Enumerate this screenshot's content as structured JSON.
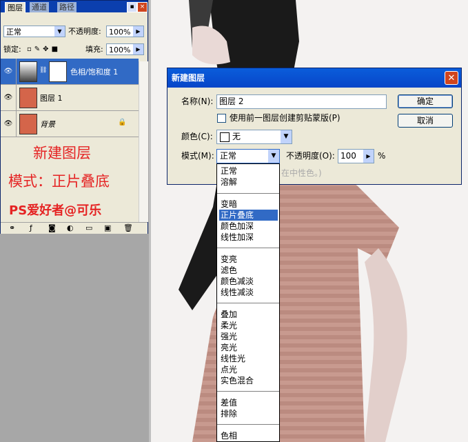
{
  "layers_panel": {
    "tabs": [
      "图层",
      "通道",
      "路径"
    ],
    "blend_mode": "正常",
    "opacity_label": "不透明度:",
    "opacity_value": "100%",
    "lock_label": "锁定:",
    "fill_label": "填充:",
    "fill_value": "100%",
    "layers": [
      {
        "name": "色相/饱和度 1",
        "selected": true
      },
      {
        "name": "图层 1",
        "selected": false
      },
      {
        "name": "背景",
        "selected": false,
        "locked": true
      }
    ],
    "annotation": {
      "line1": "新建图层",
      "line2": "模式：正片叠底",
      "line3": "PS爱好者@可乐"
    }
  },
  "dialog": {
    "title": "新建图层",
    "name_label": "名称(N):",
    "name_value": "图层 2",
    "ok_label": "确定",
    "cancel_label": "取消",
    "clip_checkbox_label": "使用前一图层创建剪贴蒙版(P)",
    "clip_checked": false,
    "color_label": "颜色(C):",
    "color_value": "无",
    "mode_label": "模式(M):",
    "mode_value": "正常",
    "opacity_label": "不透明度(O):",
    "opacity_value": "100",
    "opacity_unit": "%",
    "hint_text": "在中性色。)"
  },
  "mode_dropdown": {
    "groups": [
      [
        "正常",
        "溶解"
      ],
      [
        "变暗",
        "正片叠底",
        "颜色加深",
        "线性加深"
      ],
      [
        "变亮",
        "滤色",
        "颜色减淡",
        "线性减淡"
      ],
      [
        "叠加",
        "柔光",
        "强光",
        "亮光",
        "线性光",
        "点光",
        "实色混合"
      ],
      [
        "差值",
        "排除"
      ],
      [
        "色相"
      ]
    ],
    "highlighted": "正片叠底"
  },
  "colors": {
    "accent": "#316ac5",
    "title_bar": "#0a5ddb",
    "annotation_red": "#e52323"
  }
}
